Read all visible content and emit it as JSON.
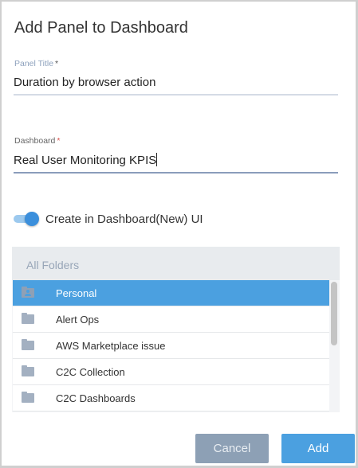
{
  "dialog": {
    "title": "Add Panel to Dashboard"
  },
  "panel_title": {
    "label": "Panel Title",
    "required": "*",
    "value": "Duration by browser action"
  },
  "dashboard": {
    "label": "Dashboard",
    "required": "*",
    "value": "Real User Monitoring KPIS"
  },
  "toggle": {
    "label": "Create in Dashboard(New) UI",
    "on": true
  },
  "folders": {
    "header": "All Folders",
    "items": [
      {
        "label": "Personal",
        "icon": "personal-folder-icon",
        "selected": true
      },
      {
        "label": "Alert Ops",
        "icon": "folder-icon"
      },
      {
        "label": "AWS Marketplace issue",
        "icon": "folder-icon"
      },
      {
        "label": "C2C Collection",
        "icon": "folder-icon"
      },
      {
        "label": "C2C Dashboards",
        "icon": "folder-icon"
      }
    ]
  },
  "buttons": {
    "cancel": "Cancel",
    "add": "Add"
  },
  "colors": {
    "accent": "#4ba0e0",
    "cancel": "#8da0b5"
  }
}
